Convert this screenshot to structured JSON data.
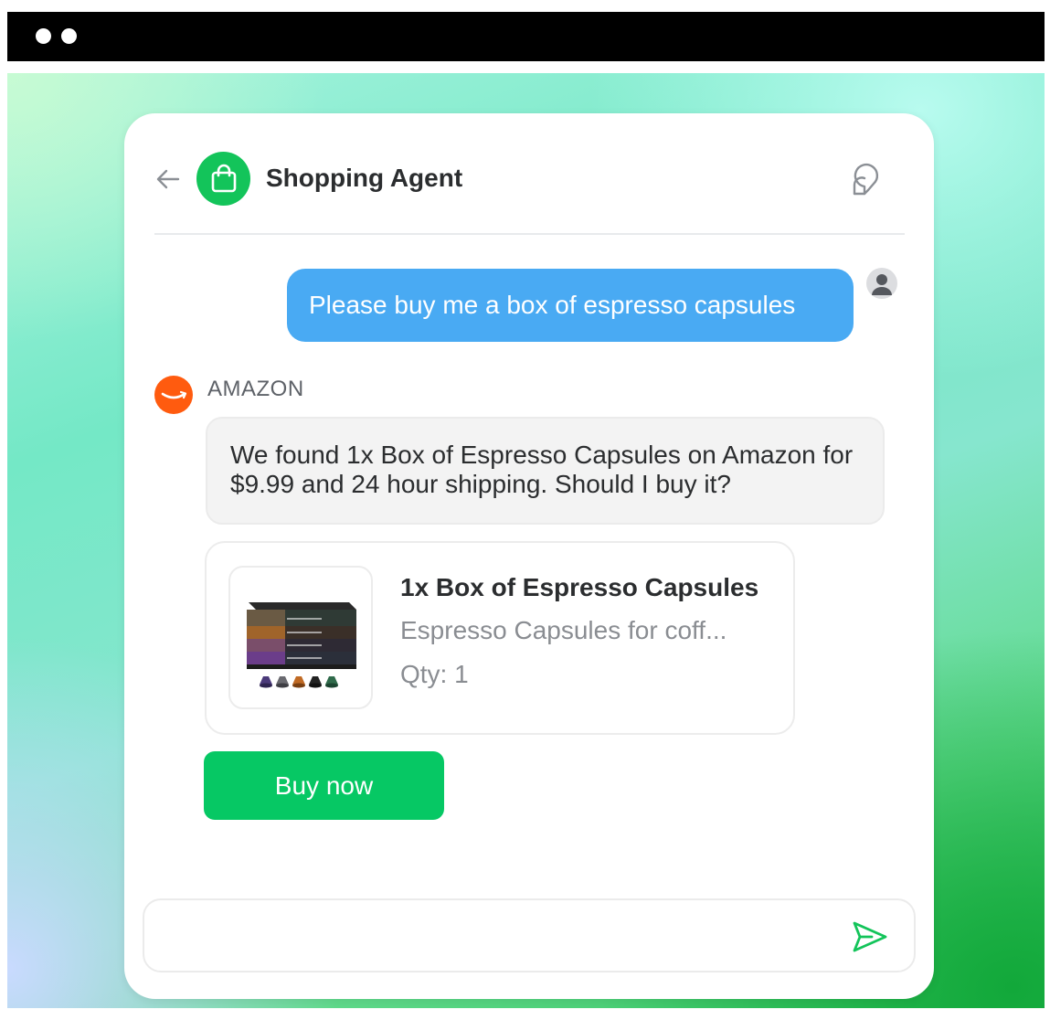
{
  "window": {
    "controls": [
      "dot",
      "dot"
    ]
  },
  "header": {
    "title": "Shopping Agent",
    "back_icon": "arrow-left-icon",
    "avatar_icon": "shopping-bag-icon",
    "chat_icon": "chat-bubble-icon"
  },
  "messages": {
    "user": {
      "text": "Please buy me a box of espresso capsules",
      "avatar_icon": "user-icon"
    },
    "agent": {
      "sender": "AMAZON",
      "logo_icon": "amazon-smile-icon",
      "text": "We found 1x Box of Espresso Capsules on Amazon for $9.99 and 24 hour shipping. Should I buy it?"
    }
  },
  "product": {
    "name": "1x Box of Espresso Capsules",
    "description": "Espresso Capsules for coff...",
    "qty": "Qty: 1",
    "image_icon": "espresso-capsules-image"
  },
  "actions": {
    "buy_label": "Buy now"
  },
  "composer": {
    "value": "",
    "placeholder": "",
    "send_icon": "send-icon"
  },
  "colors": {
    "accent_green": "#06c864",
    "user_bubble": "#49aaf3",
    "amazon_orange": "#ff5b0f"
  }
}
